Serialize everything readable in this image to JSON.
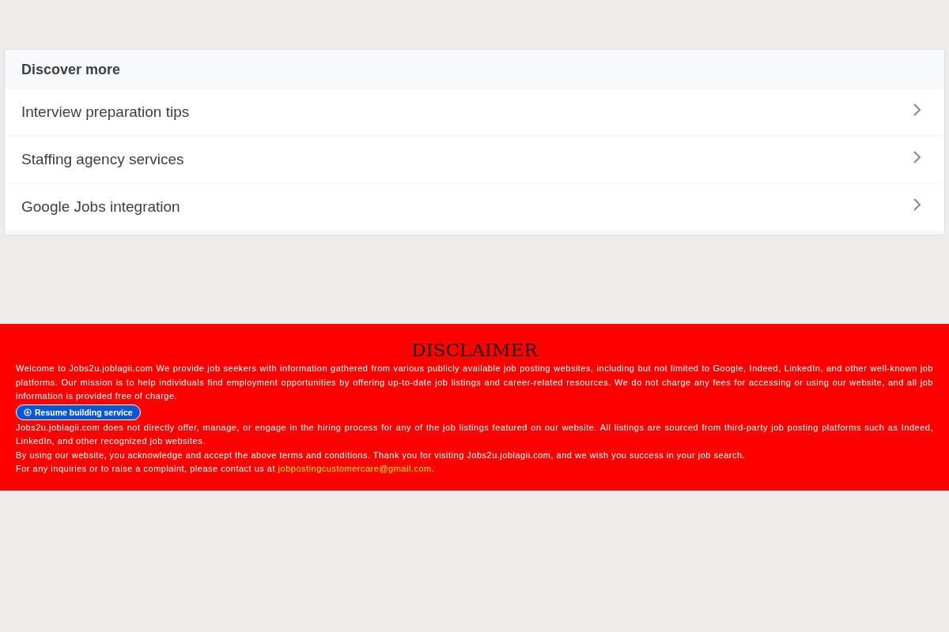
{
  "discover": {
    "title": "Discover more",
    "items": [
      {
        "label": "Interview preparation tips"
      },
      {
        "label": "Staffing agency services"
      },
      {
        "label": "Google Jobs integration"
      }
    ]
  },
  "disclaimer": {
    "title": "DISCLAIMER",
    "intro": "Welcome to Jobs2u.joblagii.com We provide job seekers with information gathered from various publicly available job posting websites, including but not limited to Google, Indeed, LinkedIn, and other well-known job platforms. Our mission is to help individuals find employment opportunities by offering up-to-date job listings and career-related resources. We do not charge any fees for accessing or using our website, and all job information is provided free of charge.",
    "button": "Resume building service",
    "paragraphs": [
      "Jobs2u.joblagii.com does not directly offer, manage, or engage in the hiring process for any of the job listings featured on our website. All listings are sourced from third-party job posting platforms such as Indeed, LinkedIn, and other recognized job websites.",
      "By using our website, you acknowledge and accept the above terms and conditions. Thank you for visiting Jobs2u.joblagii.com, and we wish you success in your job search."
    ],
    "contact": {
      "text": "For any inquiries or to raise a complaint, please contact us at",
      "email": "jobpostingcustomercare@gmail.com",
      "after": "."
    }
  }
}
